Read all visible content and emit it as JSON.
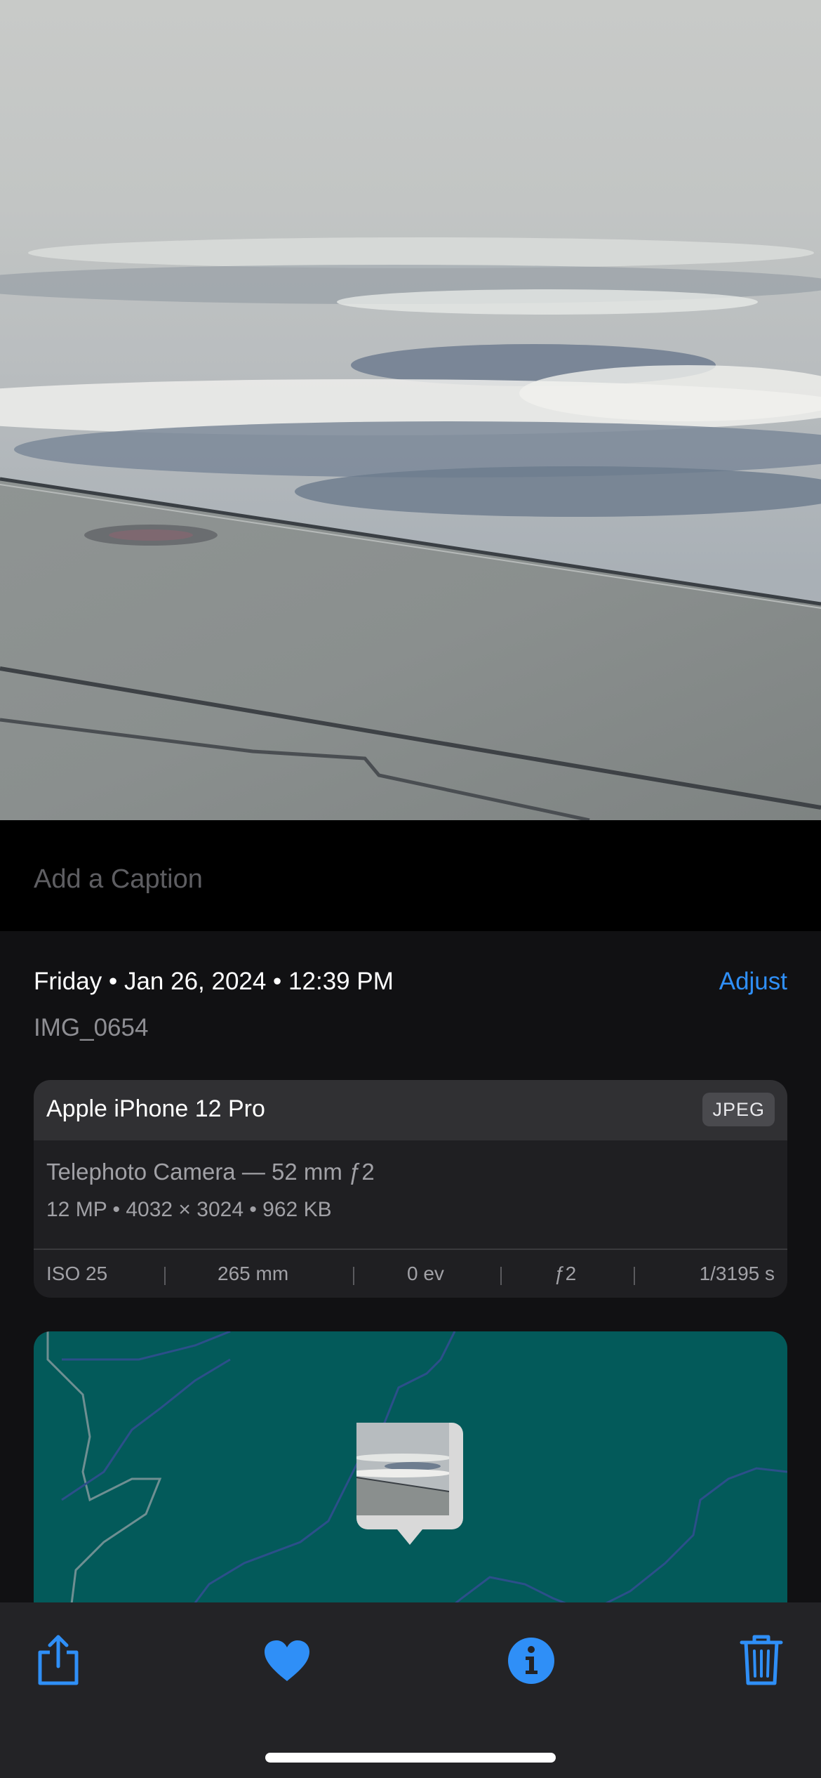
{
  "caption": {
    "placeholder": "Add a Caption",
    "value": ""
  },
  "metadata": {
    "date_line": "Friday • Jan 26, 2024 • 12:39 PM",
    "adjust_label": "Adjust",
    "filename": "IMG_0654"
  },
  "device_card": {
    "device": "Apple iPhone 12 Pro",
    "format": "JPEG",
    "camera": "Telephoto Camera — 52 mm ƒ2",
    "specs": "12 MP  •  4032 × 3024  •  962 KB",
    "exif": {
      "iso": "ISO 25",
      "focal_length": "265 mm",
      "exposure_value": "0 ev",
      "aperture": "ƒ2",
      "shutter": "1/3195 s"
    }
  },
  "toolbar": {
    "share_icon": "share-icon",
    "favorite_icon": "heart-icon",
    "info_icon": "info-icon",
    "delete_icon": "trash-icon"
  },
  "colors": {
    "accent": "#2f8ff7",
    "background": "#111113",
    "card": "#1f1f22",
    "map_water": "#035a5a",
    "toolbar": "#232326"
  }
}
